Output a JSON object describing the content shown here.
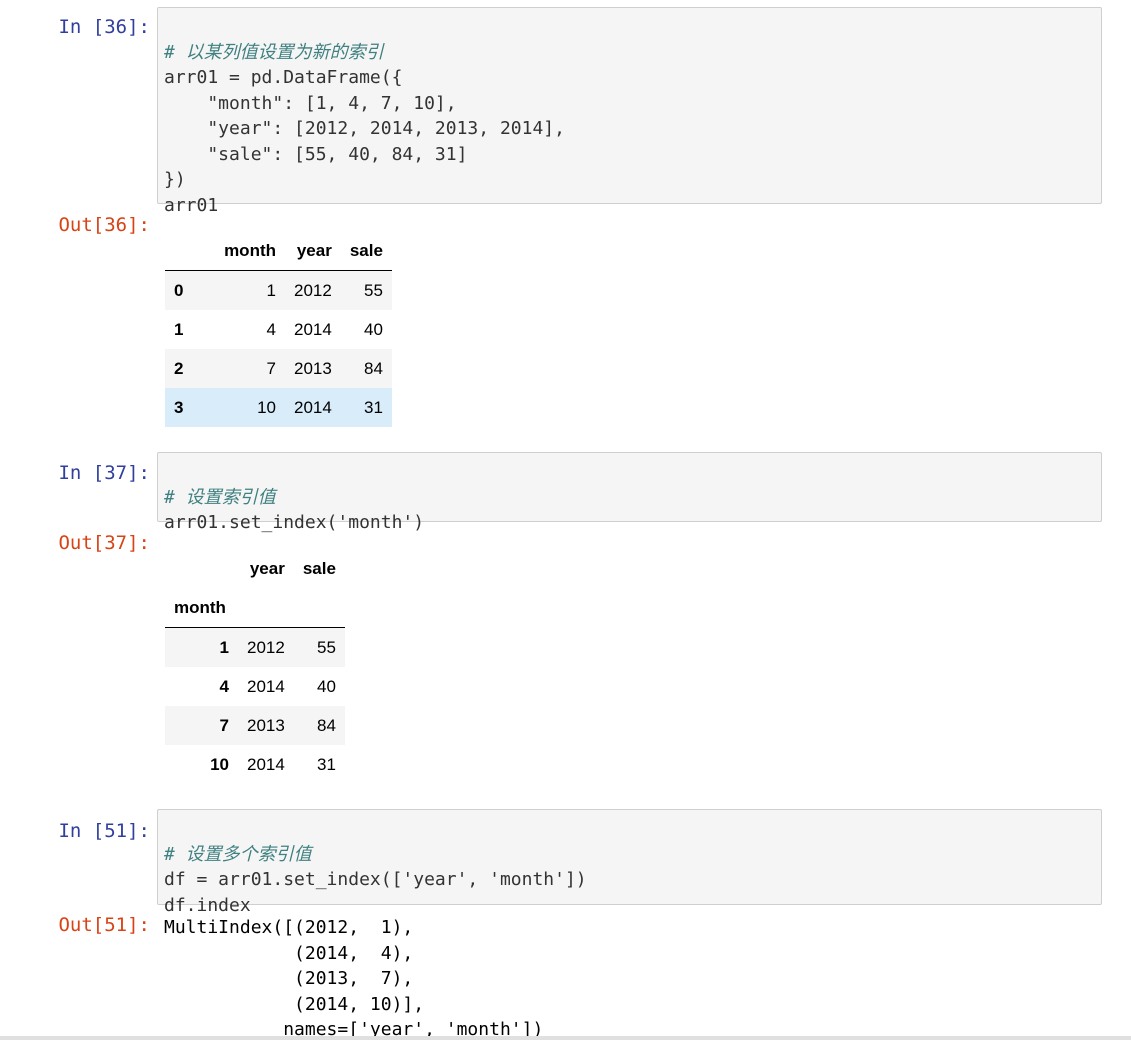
{
  "cells": [
    {
      "in_prompt": "In  [36]:",
      "out_prompt": "Out[36]:",
      "code_lines": [
        "# 以某列值设置为新的索引",
        "arr01 = pd.DataFrame({",
        "    \"month\": [1, 4, 7, 10],",
        "    \"year\": [2012, 2014, 2013, 2014],",
        "    \"sale\": [55, 40, 84, 31]",
        "})",
        "arr01"
      ],
      "table": {
        "columns": [
          "",
          "month",
          "year",
          "sale"
        ],
        "rows": [
          [
            "0",
            "1",
            "2012",
            "55"
          ],
          [
            "1",
            "4",
            "2014",
            "40"
          ],
          [
            "2",
            "7",
            "2013",
            "84"
          ],
          [
            "3",
            "10",
            "2014",
            "31"
          ]
        ]
      }
    },
    {
      "in_prompt": "In  [37]:",
      "out_prompt": "Out[37]:",
      "code_lines": [
        "# 设置索引值",
        "arr01.set_index('month')"
      ],
      "table": {
        "columns": [
          "",
          "year",
          "sale"
        ],
        "index_name": "month",
        "rows": [
          [
            "1",
            "2012",
            "55"
          ],
          [
            "4",
            "2014",
            "40"
          ],
          [
            "7",
            "2013",
            "84"
          ],
          [
            "10",
            "2014",
            "31"
          ]
        ]
      }
    },
    {
      "in_prompt": "In  [51]:",
      "out_prompt": "Out[51]:",
      "code_lines": [
        "# 设置多个索引值",
        "df = arr01.set_index(['year', 'month'])",
        "df.index"
      ],
      "output_lines": [
        "MultiIndex([(2012,  1),",
        "            (2014,  4),",
        "            (2013,  7),",
        "            (2014, 10)],",
        "           names=['year', 'month'])"
      ]
    }
  ]
}
